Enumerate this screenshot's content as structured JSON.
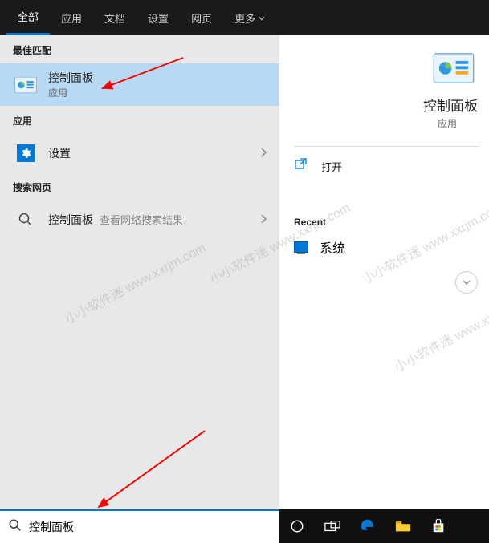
{
  "topbar": {
    "tabs": [
      "全部",
      "应用",
      "文档",
      "设置",
      "网页",
      "更多"
    ]
  },
  "left": {
    "best_match_header": "最佳匹配",
    "best_match": {
      "title": "控制面板",
      "subtitle": "应用"
    },
    "apps_header": "应用",
    "settings_item": "设置",
    "web_header": "搜索网页",
    "web_item_prefix": "控制面板",
    "web_item_suffix": " - 查看网络搜索结果"
  },
  "right": {
    "title": "控制面板",
    "subtitle": "应用",
    "open_label": "打开",
    "recent_header": "Recent",
    "recent_items": [
      "系统"
    ]
  },
  "searchbox": {
    "value": "控制面板"
  },
  "watermark": "小小软件迷 www.xxrjm.com"
}
